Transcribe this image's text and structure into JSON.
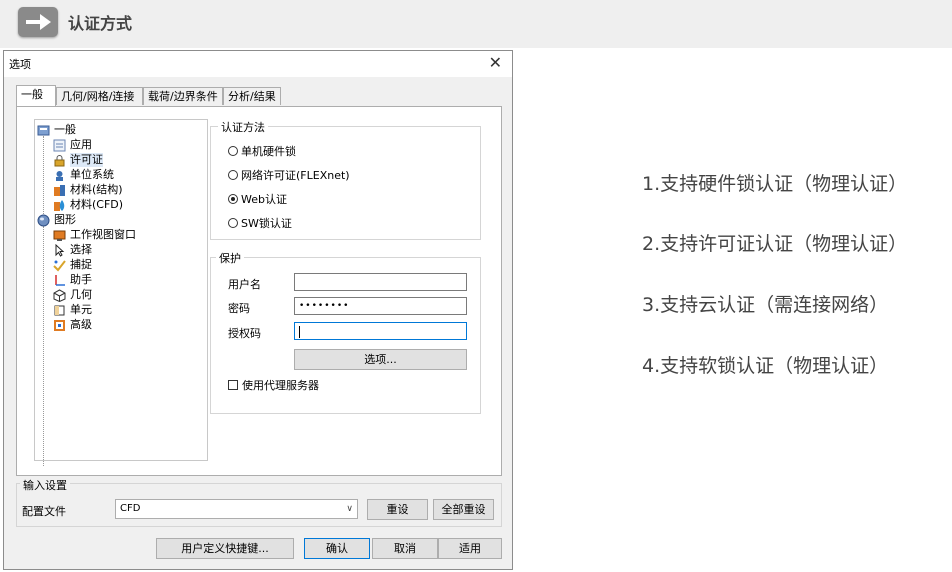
{
  "header": {
    "title": "认证方式"
  },
  "dialog": {
    "title": "选项",
    "tabs": [
      "一般",
      "几何/网格/连接",
      "载荷/边界条件",
      "分析/结果"
    ],
    "tree": {
      "general": "一般",
      "general_children": [
        "应用",
        "许可证",
        "单位系统",
        "材料(结构)",
        "材料(CFD)"
      ],
      "graphics": "图形",
      "graphics_children": [
        "工作视图窗口",
        "选择",
        "捕捉",
        "助手",
        "几何",
        "单元",
        "高级"
      ]
    },
    "auth_method": {
      "label": "认证方法",
      "options": [
        "单机硬件锁",
        "网络许可证(FLEXnet)",
        "Web认证",
        "SW锁认证"
      ],
      "selected": "Web认证"
    },
    "protection": {
      "label": "保护",
      "username_label": "用户名",
      "username_value": "",
      "password_label": "密码",
      "password_value": "••••••••",
      "auth_code_label": "授权码",
      "auth_code_value": "",
      "options_button": "选项...",
      "proxy_label": "使用代理服务器"
    },
    "input_settings": {
      "label": "输入设置",
      "profile_label": "配置文件",
      "profile_value": "CFD",
      "reset_button": "重设",
      "reset_all_button": "全部重设"
    },
    "footer": {
      "shortcut_button": "用户定义快捷键...",
      "ok_button": "确认",
      "cancel_button": "取消",
      "apply_button": "适用"
    }
  },
  "features": [
    "1.支持硬件锁认证（物理认证）",
    "2.支持许可证认证（物理认证）",
    "3.支持云认证（需连接网络）",
    "4.支持软锁认证（物理认证）"
  ]
}
